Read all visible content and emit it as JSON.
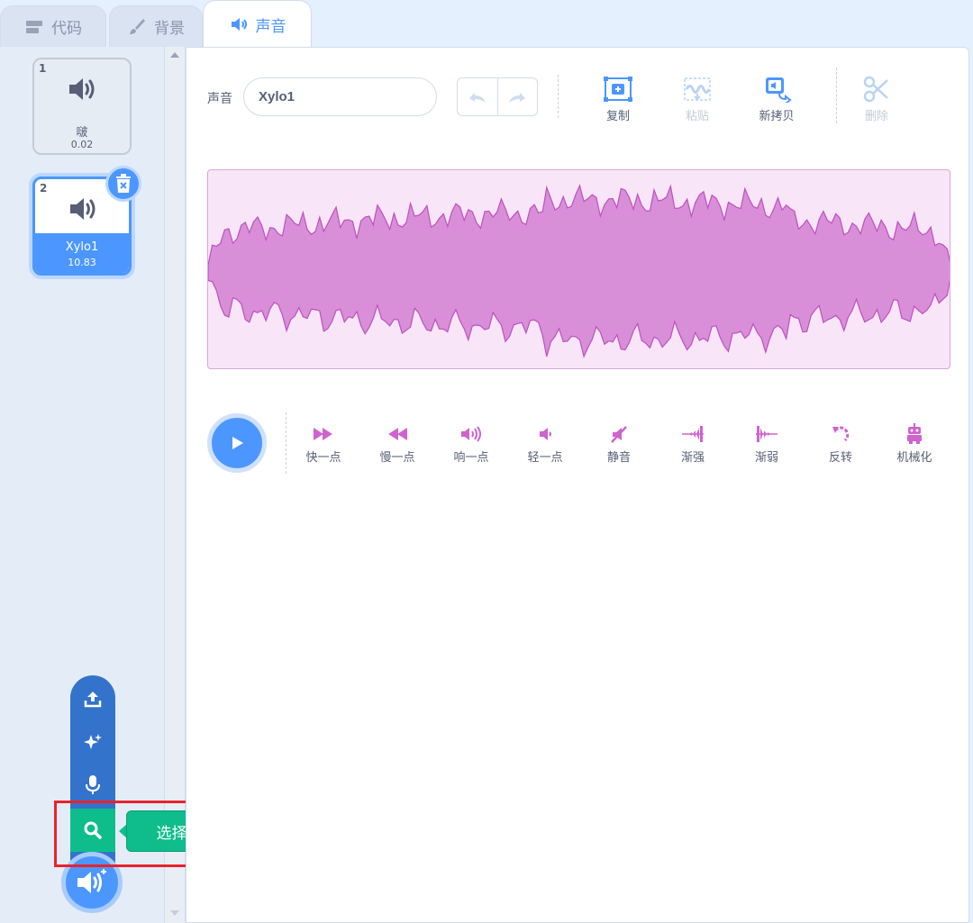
{
  "tabs": [
    {
      "label": "代码",
      "icon": "code-blocks-icon"
    },
    {
      "label": "背景",
      "icon": "brush-icon"
    },
    {
      "label": "声音",
      "icon": "sound-icon"
    }
  ],
  "sounds": [
    {
      "number": "1",
      "name": "啵",
      "duration": "0.02"
    },
    {
      "number": "2",
      "name": "Xylo1",
      "duration": "10.83"
    }
  ],
  "editor": {
    "sound_label": "声音",
    "sound_name": "Xylo1",
    "tools": {
      "copy": "复制",
      "paste": "粘贴",
      "copy_to_new": "新拷贝",
      "delete": "删除"
    }
  },
  "effects": [
    {
      "label": "快一点",
      "icon": "faster-icon"
    },
    {
      "label": "慢一点",
      "icon": "slower-icon"
    },
    {
      "label": "响一点",
      "icon": "louder-icon"
    },
    {
      "label": "轻一点",
      "icon": "softer-icon"
    },
    {
      "label": "静音",
      "icon": "mute-icon"
    },
    {
      "label": "渐强",
      "icon": "fade-in-icon"
    },
    {
      "label": "渐弱",
      "icon": "fade-out-icon"
    },
    {
      "label": "反转",
      "icon": "reverse-icon"
    },
    {
      "label": "机械化",
      "icon": "robot-icon"
    }
  ],
  "add_menu": {
    "tooltip": "选择一个声音"
  },
  "colors": {
    "accent": "#4c97ff",
    "effect_pink": "#cf63cf",
    "wave_fill": "#d88fd8",
    "search_green": "#0fbd8c",
    "highlight_red": "#e8232c"
  }
}
